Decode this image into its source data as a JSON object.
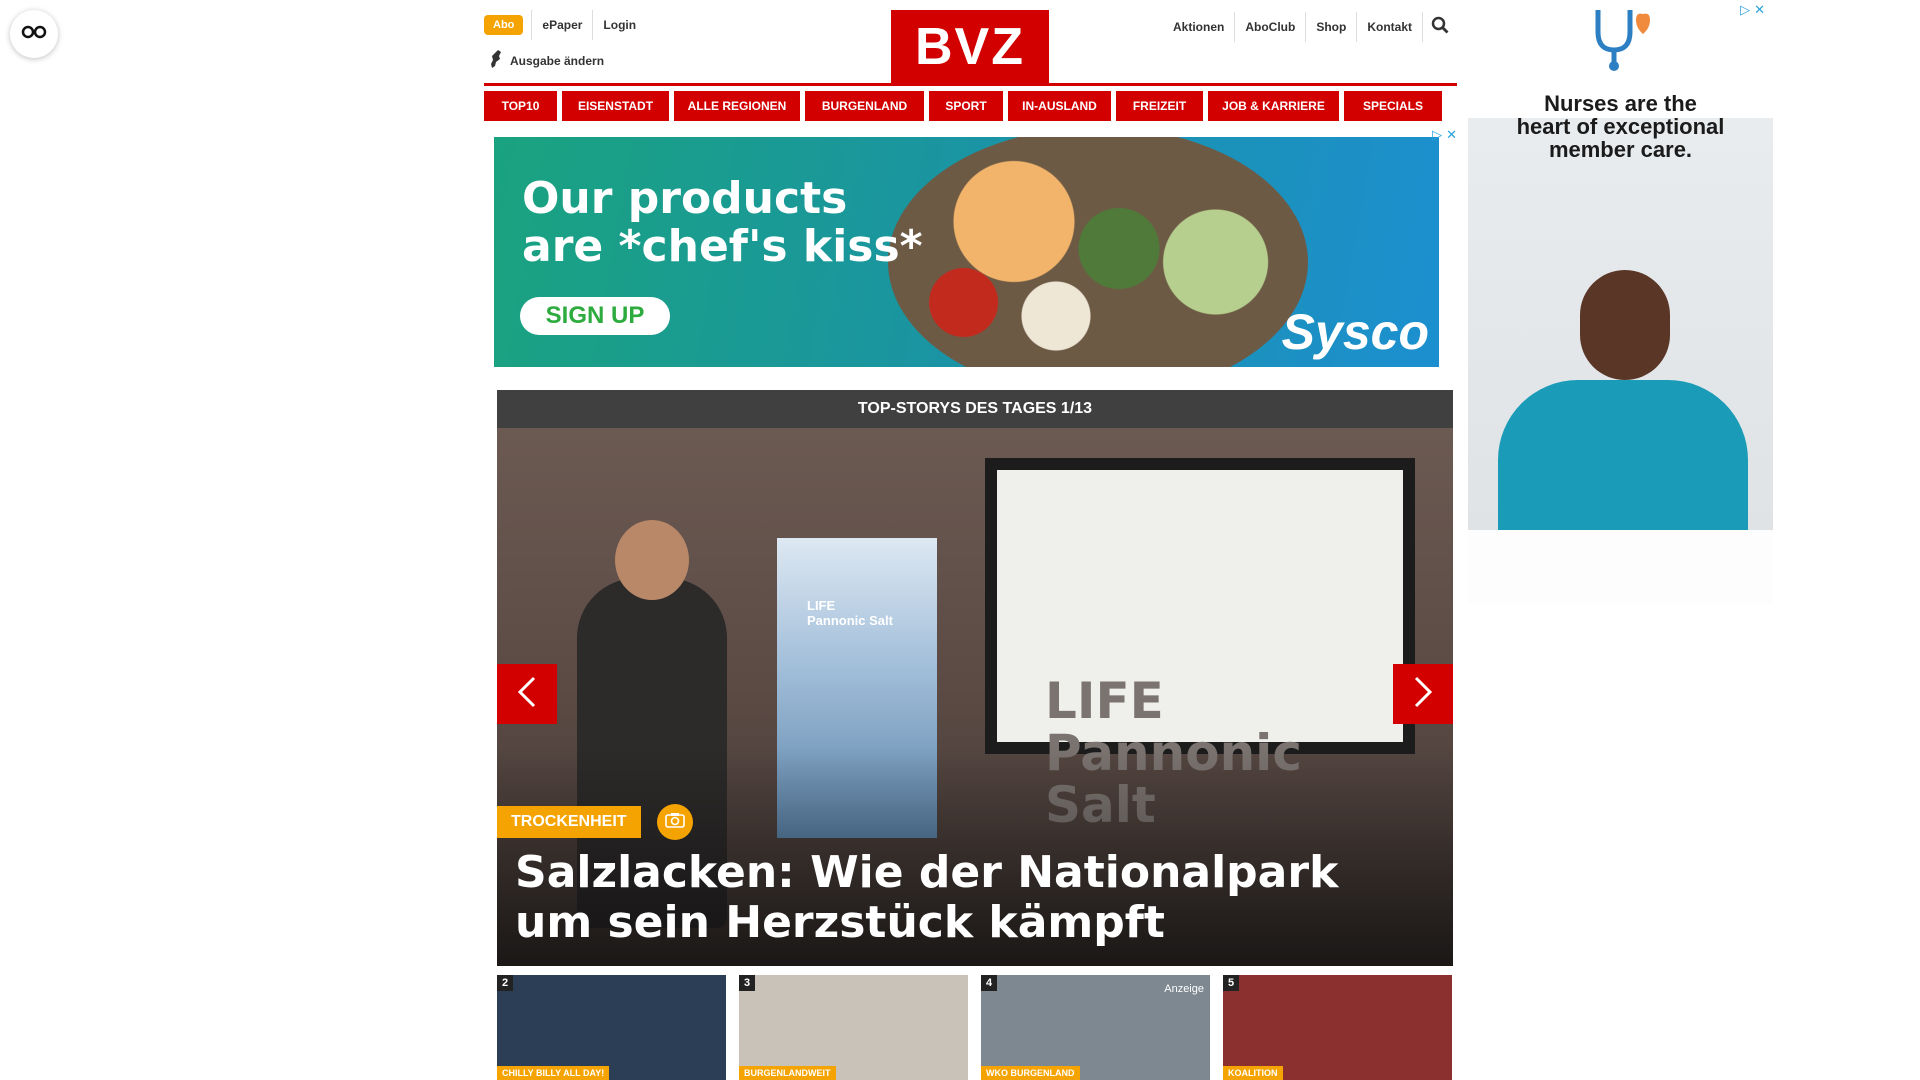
{
  "utility": {
    "abo": "Abo",
    "epaper": "ePaper",
    "login": "Login",
    "edition": "Ausgabe ändern",
    "right_links": [
      "Aktionen",
      "AboClub",
      "Shop",
      "Kontakt"
    ]
  },
  "logo": "BVZ",
  "nav": [
    "TOP10",
    "EISENSTADT",
    "ALLE REGIONEN",
    "BURGENLAND",
    "SPORT",
    "IN-AUSLAND",
    "FREIZEIT",
    "JOB & KARRIERE",
    "SPECIALS"
  ],
  "ad_banner": {
    "headline_1": "Our products",
    "headline_2": "are *chef's kiss*",
    "cta": "SIGN UP",
    "brand": "Sysco"
  },
  "stories": {
    "header": "TOP-STORYS DES TAGES 1/13",
    "tag": "TROCKENHEIT",
    "title": "Salzlacken: Wie der Nationalpark um sein Herzstück kämpft",
    "screen_line_1": "LIFE",
    "screen_line_2": "Pannonic Salt",
    "banner_line_1": "LIFE",
    "banner_line_2": "Pannonic Salt"
  },
  "thumbnails": [
    {
      "num": "2",
      "tag": "CHILLY BILLY ALL DAY!",
      "bg": "#2c3e56"
    },
    {
      "num": "3",
      "tag": "BURGENLANDWEIT",
      "bg": "#c9c2b8"
    },
    {
      "num": "4",
      "tag": "WKO BURGENLAND",
      "bg": "#7d8890",
      "anzeige": "Anzeige"
    },
    {
      "num": "5",
      "tag": "KOALITION",
      "bg": "#8b2f2f"
    }
  ],
  "side_ad": {
    "line_1": "Nurses are the",
    "line_2": "heart of exceptional",
    "line_3": "member care."
  },
  "colors": {
    "brand_red": "#d30000",
    "accent_orange": "#f5a300",
    "story_bar": "#404040"
  }
}
